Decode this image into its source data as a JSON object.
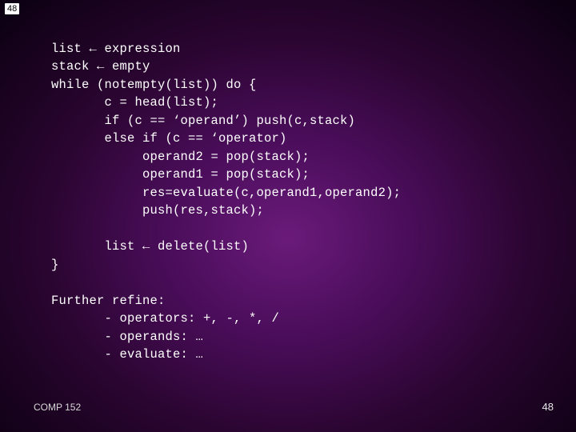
{
  "slide": {
    "top_number": "48",
    "footer_left": "COMP 152",
    "footer_right": "48"
  },
  "code": {
    "l01": "list ← expression",
    "l02": "stack ← empty",
    "l03": "while (notempty(list)) do {",
    "l04": "       c = head(list);",
    "l05": "       if (c == ‘operand’) push(c,stack)",
    "l06": "       else if (c == ‘operator)",
    "l07": "            operand2 = pop(stack);",
    "l08": "            operand1 = pop(stack);",
    "l09": "            res=evaluate(c,operand1,operand2);",
    "l10": "            push(res,stack);",
    "l11": "",
    "l12": "       list ← delete(list)",
    "l13": "}",
    "l14": "",
    "l15": "Further refine:",
    "l16": "       - operators: +, -, *, /",
    "l17": "       - operands: …",
    "l18": "       - evaluate: …"
  }
}
